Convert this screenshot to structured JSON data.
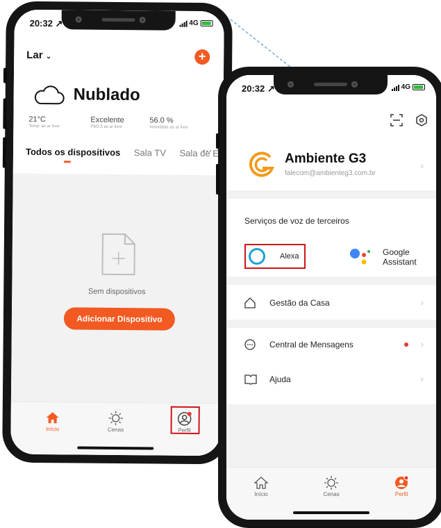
{
  "status_bar": {
    "time_left": "20:32 ↗",
    "time_right": "20:32 ↗",
    "network": "4G"
  },
  "screen1": {
    "home_selector": "Lar",
    "weather": {
      "condition": "Nublado",
      "stats": [
        {
          "value": "21°C",
          "label": "Temp. ao ar livre"
        },
        {
          "value": "Excelente",
          "label": "PM2.5 ao ar livre"
        },
        {
          "value": "56.0 %",
          "label": "Humidade ao ar livre"
        }
      ]
    },
    "tabs": [
      "Todos os dispositivos",
      "Sala TV",
      "Sala de E"
    ],
    "more": "···",
    "empty_text": "Sem dispositivos",
    "add_button": "Adicionar Dispositivo",
    "nav": [
      {
        "label": "Início"
      },
      {
        "label": "Cenas"
      },
      {
        "label": "Perfil"
      }
    ]
  },
  "screen2": {
    "account": {
      "name": "Ambiente G3",
      "email": "falecom@ambienteg3.com.br"
    },
    "voice_section": "Serviços de voz de terceiros",
    "alexa": "Alexa",
    "google": {
      "line1": "Google",
      "line2": "Assistant"
    },
    "menu": [
      {
        "label": "Gestão da Casa"
      },
      {
        "label": "Central de Mensagens"
      },
      {
        "label": "Ajuda"
      }
    ],
    "nav": [
      {
        "label": "Início"
      },
      {
        "label": "Cenas"
      },
      {
        "label": "Perfil"
      }
    ]
  },
  "colors": {
    "accent": "#f25a22",
    "alexa": "#1ba1d8",
    "highlight": "#d0131a"
  }
}
